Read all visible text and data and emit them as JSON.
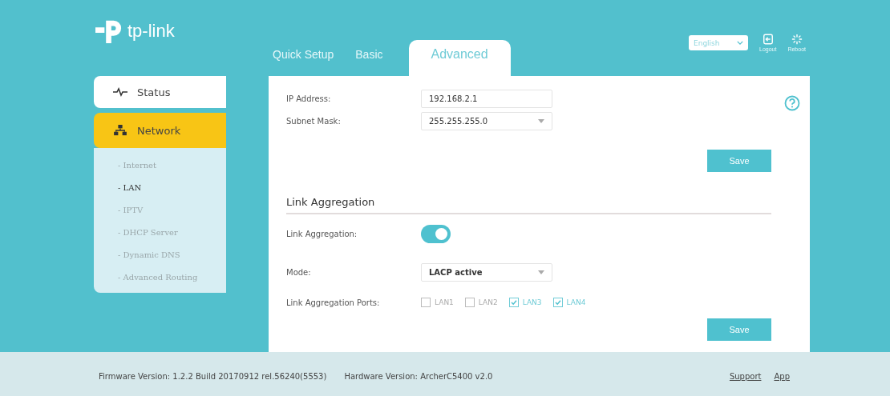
{
  "logo": {
    "text": "tp-link"
  },
  "tabs": [
    {
      "label": "Quick Setup",
      "selected": false
    },
    {
      "label": "Basic",
      "selected": false
    },
    {
      "label": "Advanced",
      "selected": true
    }
  ],
  "language": {
    "value": "English"
  },
  "header_actions": [
    {
      "label": "Logout",
      "kind": "logout"
    },
    {
      "label": "Reboot",
      "kind": "reboot"
    }
  ],
  "sidebar": {
    "items": [
      {
        "label": "Status",
        "kind": "status",
        "selected": false
      },
      {
        "label": "Network",
        "kind": "network",
        "selected": true,
        "children": [
          {
            "label": "- Internet",
            "selected": false
          },
          {
            "label": "- LAN",
            "selected": true
          },
          {
            "label": "- IPTV",
            "selected": false
          },
          {
            "label": "- DHCP Server",
            "selected": false
          },
          {
            "label": "- Dynamic DNS",
            "selected": false
          },
          {
            "label": "- Advanced Routing",
            "selected": false
          }
        ]
      }
    ]
  },
  "lan": {
    "fields": [
      {
        "label": "IP Address:",
        "kind": "input",
        "value": "192.168.2.1"
      },
      {
        "label": "Subnet Mask:",
        "kind": "select",
        "value": "255.255.255.0"
      }
    ],
    "save": "Save"
  },
  "link_aggregation": {
    "title": "Link Aggregation",
    "toggle": {
      "label": "Link Aggregation:",
      "on": true
    },
    "mode": {
      "label": "Mode:",
      "value": "LACP active"
    },
    "ports": {
      "label": "Link Aggregation Ports:",
      "items": [
        {
          "label": "LAN1",
          "checked": false
        },
        {
          "label": "LAN2",
          "checked": false
        },
        {
          "label": "LAN3",
          "checked": true
        },
        {
          "label": "LAN4",
          "checked": true
        }
      ]
    },
    "save": "Save"
  },
  "footer": {
    "firmware": "Firmware Version: 1.2.2 Build 20170912 rel.56240(5553)",
    "hardware": "Hardware Version: ArcherC5400 v2.0",
    "links": [
      "Support",
      "App"
    ]
  }
}
